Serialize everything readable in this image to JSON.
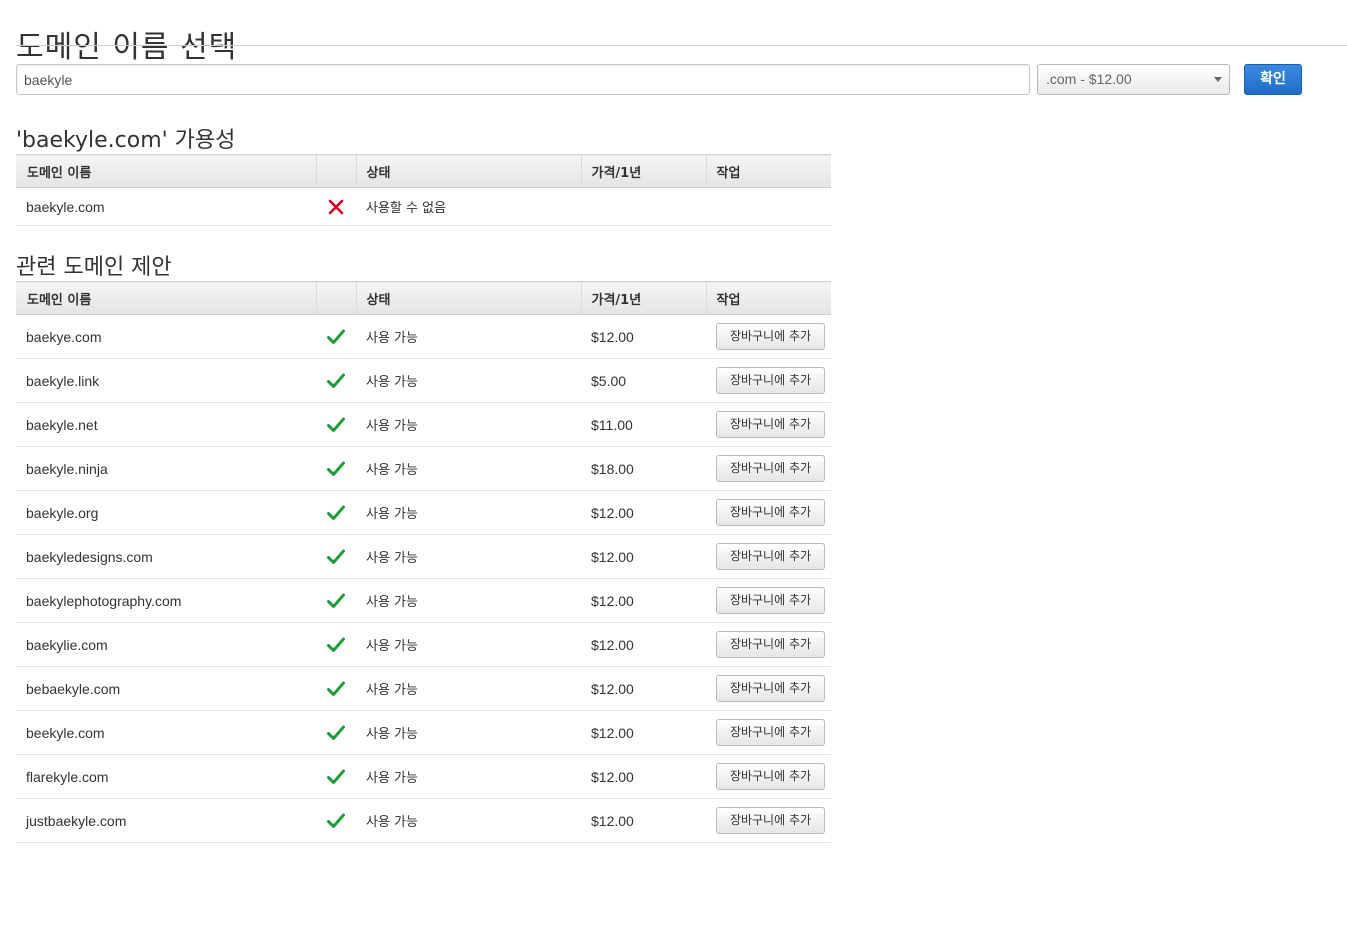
{
  "header": {
    "title": "도메인 이름 선택"
  },
  "search": {
    "value": "baekyle",
    "tld_selected": ".com - $12.00",
    "confirm_label": "확인"
  },
  "availability": {
    "title": "'baekyle.com' 가용성",
    "columns": [
      "도메인 이름",
      "",
      "상태",
      "가격/1년",
      "작업"
    ],
    "rows": [
      {
        "domain": "baekyle.com",
        "icon": "x-icon",
        "status": "사용할 수 없음",
        "price": "",
        "action": ""
      }
    ]
  },
  "suggestions": {
    "title": "관련 도메인 제안",
    "columns": [
      "도메인 이름",
      "",
      "상태",
      "가격/1년",
      "작업"
    ],
    "rows": [
      {
        "domain": "baekye.com",
        "icon": "check-icon",
        "status": "사용 가능",
        "price": "$12.00",
        "action": "장바구니에 추가"
      },
      {
        "domain": "baekyle.link",
        "icon": "check-icon",
        "status": "사용 가능",
        "price": "$5.00",
        "action": "장바구니에 추가"
      },
      {
        "domain": "baekyle.net",
        "icon": "check-icon",
        "status": "사용 가능",
        "price": "$11.00",
        "action": "장바구니에 추가"
      },
      {
        "domain": "baekyle.ninja",
        "icon": "check-icon",
        "status": "사용 가능",
        "price": "$18.00",
        "action": "장바구니에 추가"
      },
      {
        "domain": "baekyle.org",
        "icon": "check-icon",
        "status": "사용 가능",
        "price": "$12.00",
        "action": "장바구니에 추가"
      },
      {
        "domain": "baekyledesigns.com",
        "icon": "check-icon",
        "status": "사용 가능",
        "price": "$12.00",
        "action": "장바구니에 추가"
      },
      {
        "domain": "baekylephotography.com",
        "icon": "check-icon",
        "status": "사용 가능",
        "price": "$12.00",
        "action": "장바구니에 추가"
      },
      {
        "domain": "baekylie.com",
        "icon": "check-icon",
        "status": "사용 가능",
        "price": "$12.00",
        "action": "장바구니에 추가"
      },
      {
        "domain": "bebaekyle.com",
        "icon": "check-icon",
        "status": "사용 가능",
        "price": "$12.00",
        "action": "장바구니에 추가"
      },
      {
        "domain": "beekyle.com",
        "icon": "check-icon",
        "status": "사용 가능",
        "price": "$12.00",
        "action": "장바구니에 추가"
      },
      {
        "domain": "flarekyle.com",
        "icon": "check-icon",
        "status": "사용 가능",
        "price": "$12.00",
        "action": "장바구니에 추가"
      },
      {
        "domain": "justbaekyle.com",
        "icon": "check-icon",
        "status": "사용 가능",
        "price": "$12.00",
        "action": "장바구니에 추가"
      }
    ]
  },
  "colors": {
    "available": "#1e9c3a",
    "unavailable": "#d0021b",
    "primary_button": "#2573d0"
  }
}
